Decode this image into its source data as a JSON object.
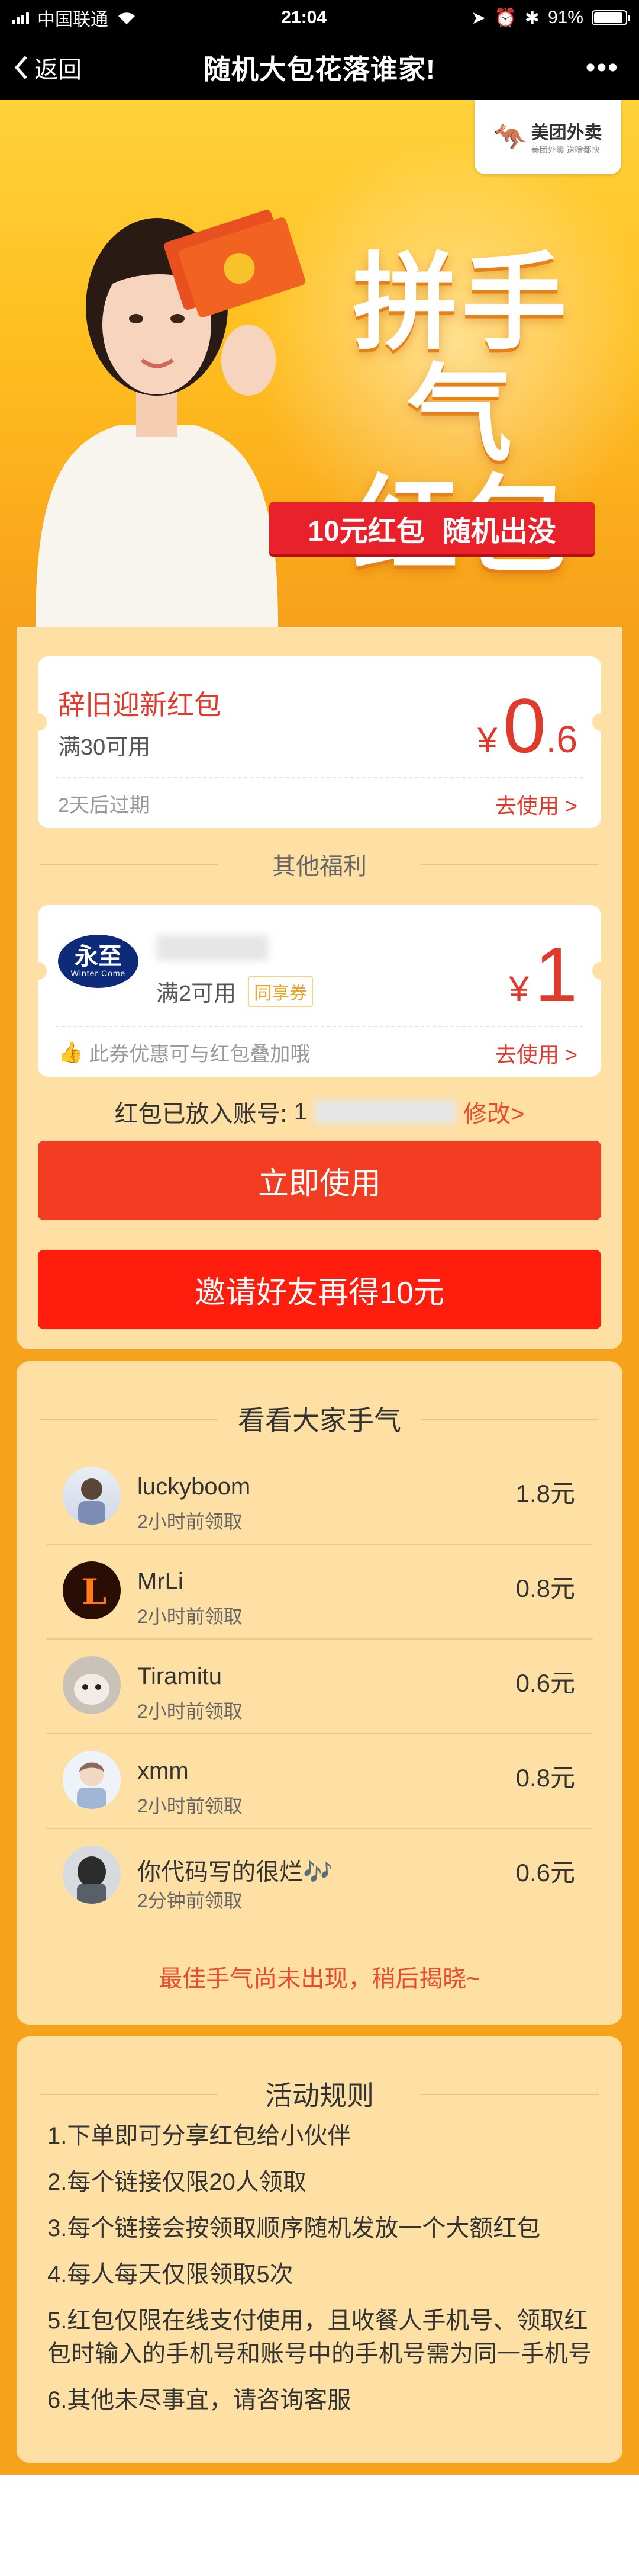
{
  "status": {
    "carrier": "中国联通",
    "time": "21:04",
    "battery": "91%",
    "battery_level": 0.91
  },
  "nav": {
    "back": "返回",
    "title": "随机大包花落谁家!",
    "more": "•••"
  },
  "hero": {
    "brand_name": "美团外卖",
    "brand_sub": "美团外卖 送啥都快",
    "title_line1": "拼手气",
    "title_line2": "红包",
    "tag1": "10元红包",
    "tag2": "随机出没"
  },
  "coupon1": {
    "title": "辞旧迎新红包",
    "condition": "满30可用",
    "expiry": "2天后过期",
    "use": "去使用 >",
    "currency": "¥",
    "amount_int": "0",
    "amount_dec": ".6"
  },
  "other": {
    "title": "其他福利"
  },
  "coupon2": {
    "logo_text": "永至",
    "logo_sub": "Winter Come",
    "condition": "满2可用",
    "tag": "同享券",
    "note": "此券优惠可与红包叠加哦",
    "use": "去使用 >",
    "currency": "¥",
    "amount": "1"
  },
  "account": {
    "label": "红包已放入账号:",
    "number_prefix": "1",
    "change": "修改>"
  },
  "buttons": {
    "use": "立即使用",
    "invite": "邀请好友再得10元"
  },
  "luck": {
    "title": "看看大家手气",
    "rows": [
      {
        "name": "luckyboom",
        "time": "2小时前领取",
        "amount": "1.8元"
      },
      {
        "name": "MrLi",
        "time": "2小时前领取",
        "amount": "0.8元"
      },
      {
        "name": "Tiramitu",
        "time": "2小时前领取",
        "amount": "0.6元"
      },
      {
        "name": "xmm",
        "time": "2小时前领取",
        "amount": "0.8元"
      },
      {
        "name": "你代码写的很烂🎶",
        "time": "2分钟前领取",
        "amount": "0.6元"
      }
    ],
    "best": "最佳手气尚未出现，稍后揭晓~"
  },
  "rules": {
    "title": "活动规则",
    "items": [
      "1.下单即可分享红包给小伙伴",
      "2.每个链接仅限20人领取",
      "3.每个链接会按领取顺序随机发放一个大额红包",
      "4.每人每天仅限领取5次",
      "5.红包仅限在线支付使用，且收餐人手机号、领取红包时输入的手机号和账号中的手机号需为同一手机号",
      "6.其他未尽事宜，请咨询客服"
    ]
  },
  "colors": {
    "accent_red": "#e03a2c",
    "button_red": "#f33d22",
    "panel": "#fee0a4",
    "orange": "#f7a21b"
  }
}
